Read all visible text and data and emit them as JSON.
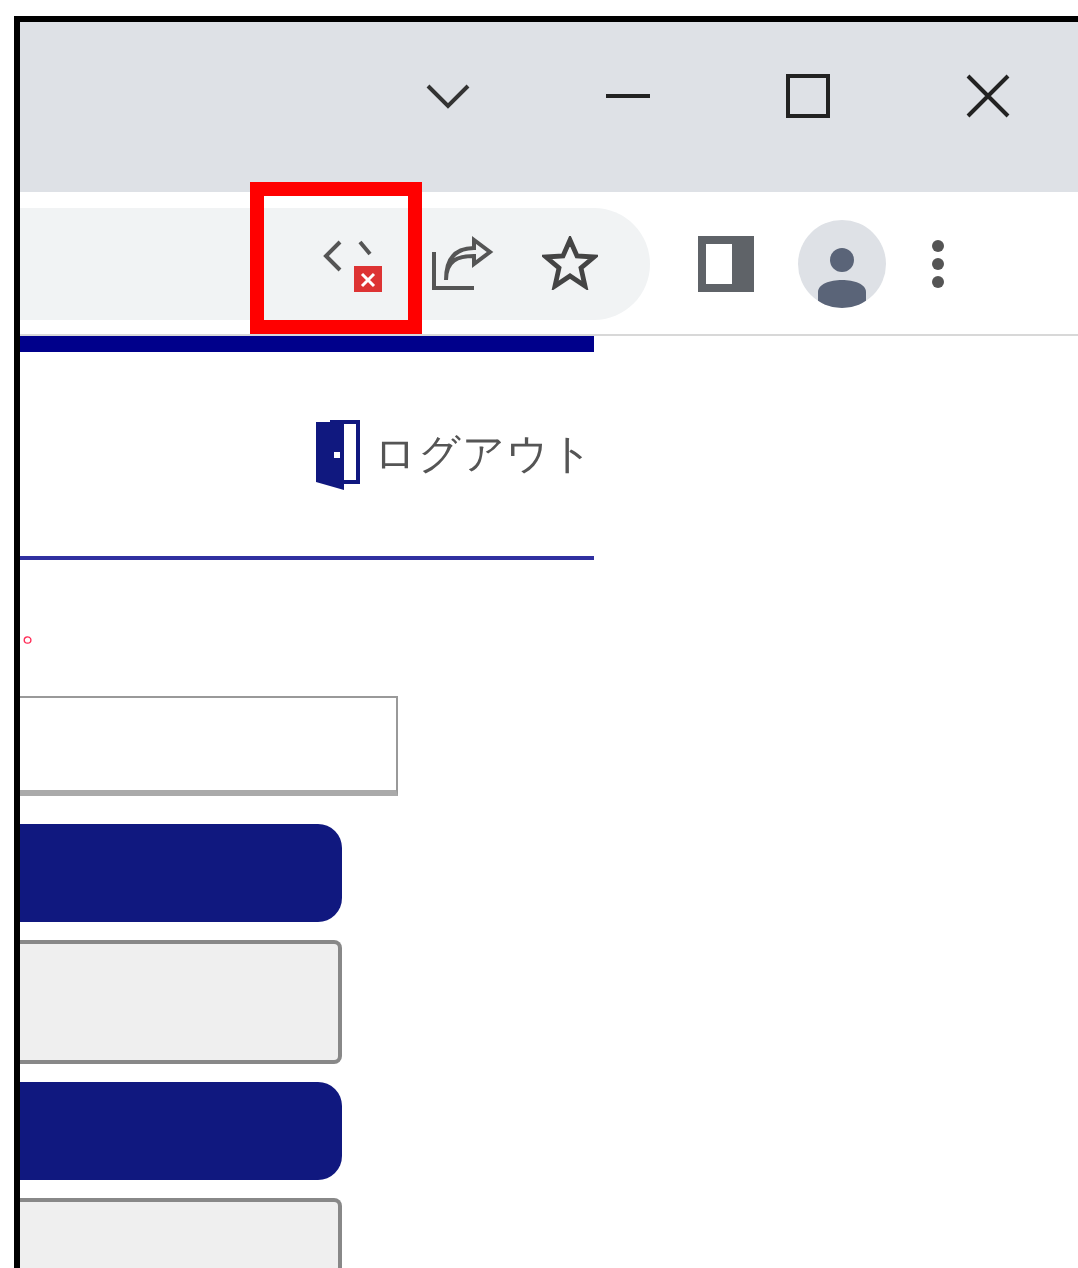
{
  "page": {
    "logout": {
      "label": "ログアウト"
    },
    "notice": "。",
    "buttons": [
      {
        "kind": "primary"
      },
      {
        "kind": "secondary"
      },
      {
        "kind": "primary"
      },
      {
        "kind": "secondary"
      }
    ]
  }
}
